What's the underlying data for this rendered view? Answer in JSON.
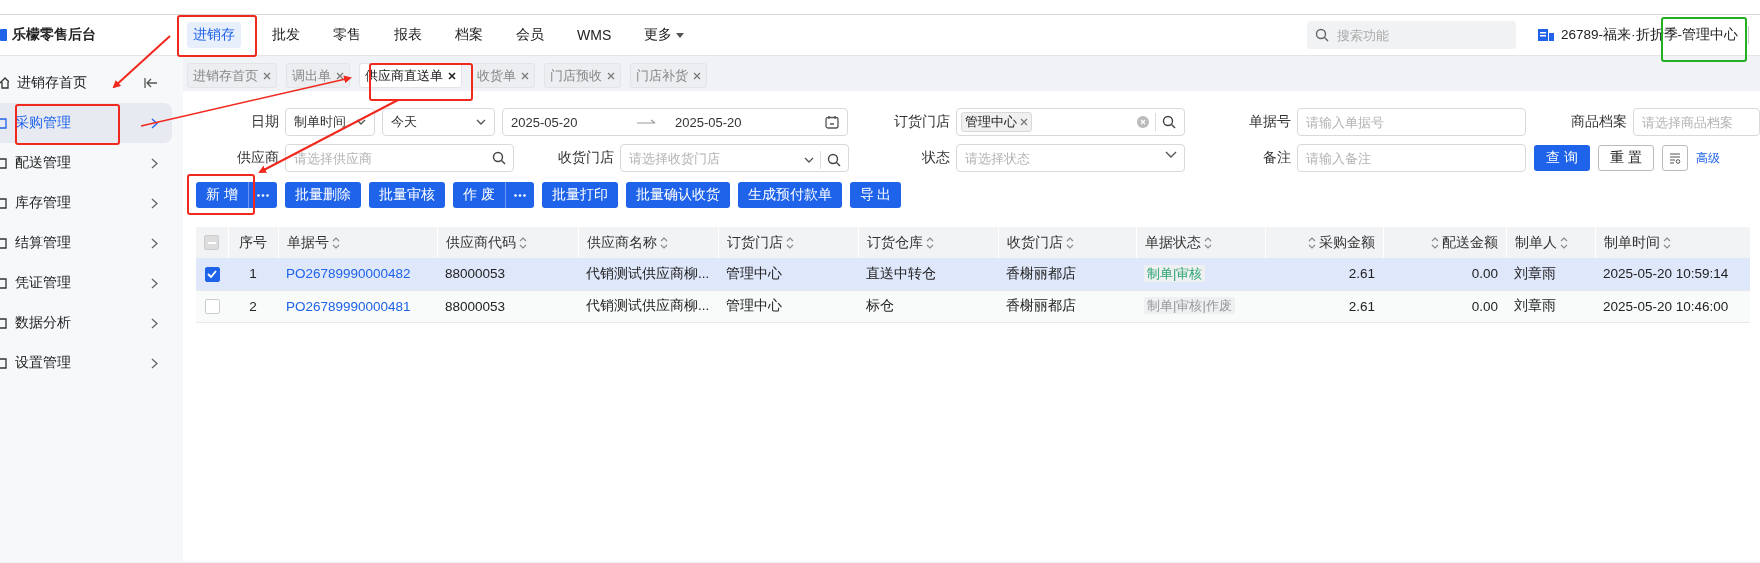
{
  "app": {
    "title": "乐檬零售后台"
  },
  "top_nav": [
    {
      "label": "进销存",
      "selected": true,
      "kind": "link"
    },
    {
      "label": "批发",
      "selected": false,
      "kind": "link"
    },
    {
      "label": "零售",
      "selected": false,
      "kind": "link"
    },
    {
      "label": "报表",
      "selected": false,
      "kind": "link"
    },
    {
      "label": "档案",
      "selected": false,
      "kind": "link"
    },
    {
      "label": "会员",
      "selected": false,
      "kind": "link"
    },
    {
      "label": "WMS",
      "selected": false,
      "kind": "link"
    },
    {
      "label": "更多",
      "selected": false,
      "kind": "dropdown"
    }
  ],
  "search": {
    "placeholder": "搜索功能"
  },
  "account": {
    "label": "26789-福来·折折季-管理中心"
  },
  "sidebar": {
    "items": [
      {
        "label": "进销存首页",
        "selected": false,
        "kind": "home"
      },
      {
        "label": "采购管理",
        "selected": true,
        "kind": "group"
      },
      {
        "label": "配送管理",
        "selected": false,
        "kind": "group"
      },
      {
        "label": "库存管理",
        "selected": false,
        "kind": "group"
      },
      {
        "label": "结算管理",
        "selected": false,
        "kind": "group"
      },
      {
        "label": "凭证管理",
        "selected": false,
        "kind": "group"
      },
      {
        "label": "数据分析",
        "selected": false,
        "kind": "group"
      },
      {
        "label": "设置管理",
        "selected": false,
        "kind": "group"
      }
    ]
  },
  "tabs": [
    {
      "label": "进销存首页",
      "selected": false
    },
    {
      "label": "调出单",
      "selected": false
    },
    {
      "label": "供应商直送单",
      "selected": true
    },
    {
      "label": "收货单",
      "selected": false
    },
    {
      "label": "门店预收",
      "selected": false
    },
    {
      "label": "门店补货",
      "selected": false
    }
  ],
  "filters": [
    {
      "label": "日期",
      "kind": "daterange",
      "type_value": "制单时间",
      "preset": "今天",
      "start": "2025-05-20",
      "end": "2025-05-20"
    },
    {
      "label": "订货门店",
      "kind": "tags",
      "tags": [
        "管理中心"
      ]
    },
    {
      "label": "单据号",
      "kind": "text",
      "placeholder": "请输入单据号"
    },
    {
      "label": "商品档案",
      "kind": "text",
      "placeholder": "请选择商品档案"
    },
    {
      "label": "供应商",
      "kind": "search",
      "placeholder": "请选择供应商"
    },
    {
      "label": "收货门店",
      "kind": "selectsearch",
      "placeholder": "请选择收货门店"
    },
    {
      "label": "状态",
      "kind": "select",
      "placeholder": "请选择状态"
    },
    {
      "label": "备注",
      "kind": "text",
      "placeholder": "请输入备注"
    }
  ],
  "query_actions": [
    {
      "label": "查 询",
      "kind": "primary"
    },
    {
      "label": "重 置",
      "kind": "default"
    },
    {
      "kind": "icon"
    },
    {
      "label": "高级",
      "kind": "link"
    }
  ],
  "toolbar": [
    {
      "label": "新 增",
      "more": true
    },
    {
      "label": "批量删除",
      "more": false
    },
    {
      "label": "批量审核",
      "more": false
    },
    {
      "label": "作 废",
      "more": true
    },
    {
      "label": "批量打印",
      "more": false
    },
    {
      "label": "批量确认收货",
      "more": false
    },
    {
      "label": "生成预付款单",
      "more": false
    },
    {
      "label": "导 出",
      "more": false
    }
  ],
  "table": {
    "select_all": {
      "indeterminate": true
    },
    "columns": [
      {
        "label": "序号",
        "sortable": false,
        "kind": "index"
      },
      {
        "label": "单据号",
        "sortable": true,
        "kind": "link"
      },
      {
        "label": "供应商代码",
        "sortable": true,
        "kind": "text"
      },
      {
        "label": "供应商名称",
        "sortable": true,
        "kind": "text"
      },
      {
        "label": "订货门店",
        "sortable": true,
        "kind": "text"
      },
      {
        "label": "订货仓库",
        "sortable": true,
        "kind": "text"
      },
      {
        "label": "收货门店",
        "sortable": true,
        "kind": "text"
      },
      {
        "label": "单据状态",
        "sortable": true,
        "kind": "status"
      },
      {
        "label": "采购金额",
        "sortable": true,
        "kind": "amount"
      },
      {
        "label": "配送金额",
        "sortable": true,
        "kind": "amount"
      },
      {
        "label": "制单人",
        "sortable": true,
        "kind": "text"
      },
      {
        "label": "制单时间",
        "sortable": true,
        "kind": "text"
      }
    ],
    "rows": [
      {
        "selected": true,
        "checked": true,
        "color": "#2ba471",
        "cells": [
          "1",
          "PO26789990000482",
          "88000053",
          "代销测试供应商柳...",
          "管理中心",
          "直送中转仓",
          "香榭丽都店",
          "制单|审核",
          "2.61",
          "0.00",
          "刘章雨",
          "2025-05-20 10:59:14"
        ]
      },
      {
        "selected": false,
        "checked": false,
        "color": "#999999",
        "cells": [
          "2",
          "PO26789990000481",
          "88000053",
          "代销测试供应商柳...",
          "管理中心",
          "标仓",
          "香榭丽都店",
          "制单|审核|作废",
          "2.61",
          "0.00",
          "刘章雨",
          "2025-05-20 10:46:00"
        ]
      }
    ]
  }
}
